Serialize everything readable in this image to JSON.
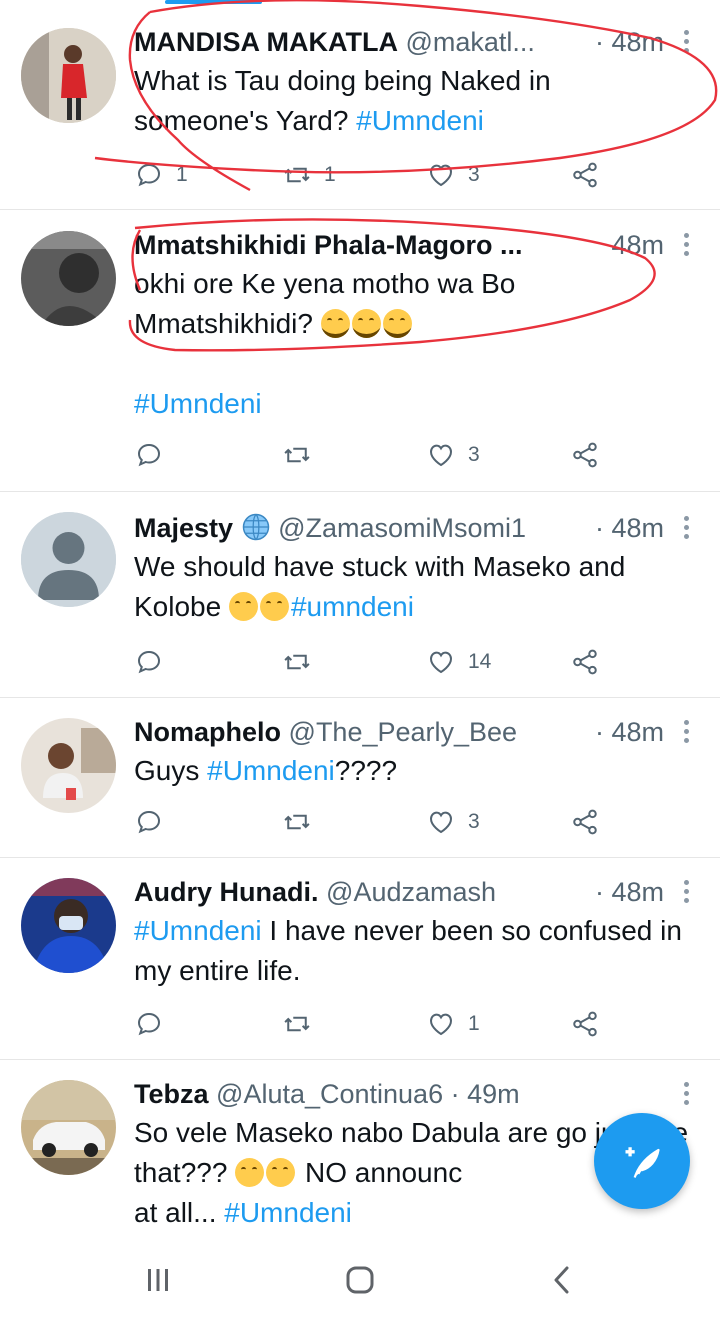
{
  "tweets": [
    {
      "name": "MANDISA MAKATLA",
      "handle": "@makatl...",
      "time": "· 48m",
      "text_before": "What is Tau doing being Naked in someone's Yard? ",
      "hashtag": "#Umndeni",
      "replies": "1",
      "retweets": "1",
      "likes": "3"
    },
    {
      "name": "Mmatshikhidi Phala-Magoro ...",
      "handle": "",
      "time": "48m",
      "text_before": "okhi ore Ke yena motho wa Bo Mmatshikhidi? ",
      "hashtag": "#Umndeni",
      "replies": "",
      "retweets": "",
      "likes": "3"
    },
    {
      "name": "Majesty",
      "handle": "@ZamasomiMsomi1",
      "time": "· 48m",
      "text_before": "We should have stuck with Maseko and Kolobe ",
      "hashtag": "#umndeni",
      "replies": "",
      "retweets": "",
      "likes": "14"
    },
    {
      "name": "Nomaphelo",
      "handle": "@The_Pearly_Bee",
      "time": "· 48m",
      "text_before": "Guys ",
      "hashtag": "#Umndeni",
      "text_after": "????",
      "replies": "",
      "retweets": "",
      "likes": "3"
    },
    {
      "name": "Audry Hunadi.",
      "handle": "@Audzamash",
      "time": "· 48m",
      "hashtag": "#Umndeni",
      "text_after": " I have never been so confused in my entire life.",
      "replies": "",
      "retweets": "",
      "likes": "1"
    },
    {
      "name": "Tebza",
      "handle": "@Aluta_Continua6",
      "time": "· 49m",
      "text_before": "So vele Maseko nabo Dabula are go just like that??? ",
      "text_mid": " NO announc",
      "text_end": "at all... ",
      "hashtag": "#Umndeni"
    }
  ],
  "colors": {
    "accent": "#1d9bf0",
    "secondary_text": "#536471",
    "annotation": "#e8323c"
  },
  "icons": [
    "reply-icon",
    "retweet-icon",
    "like-icon",
    "share-icon",
    "compose-tweet-icon",
    "recents-icon",
    "home-icon",
    "back-icon"
  ]
}
